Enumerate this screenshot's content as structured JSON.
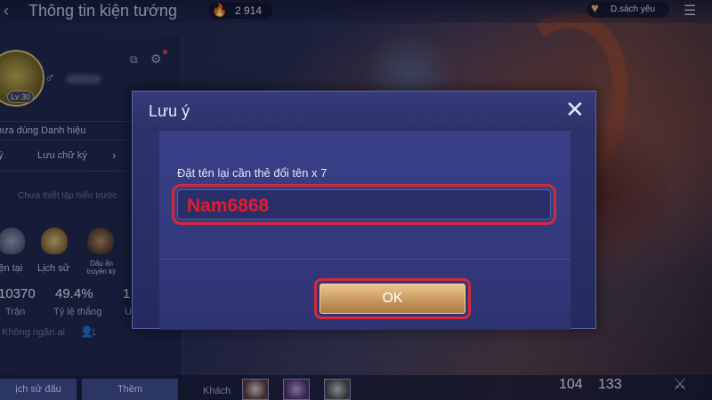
{
  "topbar": {
    "title": "Thông tin kiện tướng",
    "currency_value": "2 914",
    "favorites_label": "D.sách yêu"
  },
  "profile": {
    "level": "Lv 30",
    "title_label": "hưa dùng Danh hiệu",
    "signature_left": "ý",
    "signature_save": "Lưu chữ ký",
    "signature_placeholder": "Chưa thiết lập hiển trước",
    "medals": [
      "iện tại",
      "Lịch sử",
      "Dấu ấn truyền kỳ"
    ],
    "stats": [
      {
        "value": "10370",
        "label": "Trận"
      },
      {
        "value": "49.4%",
        "label": "Tỷ lệ thắng"
      },
      {
        "value": "1",
        "label": "U"
      }
    ],
    "visibility_text": "Không ngăn ai",
    "visibility_count": "1"
  },
  "bottombar": {
    "history_label": "ịch sử đấu",
    "add_label": "Thêm",
    "guest_label": "Khách",
    "count_a": "104",
    "count_b": "133"
  },
  "modal": {
    "title": "Lưu ý",
    "prompt": "Đặt tên lại cần thẻ đổi tên x 7",
    "name_value": "Nam6868",
    "ok_label": "OK"
  },
  "colors": {
    "highlight_border": "#d22a3a",
    "name_text": "#e21b2e",
    "ok_button": "#c99a5f",
    "modal_bg": "#2f3470"
  },
  "icons": [
    "back-arrow-icon",
    "fire-icon",
    "heart-icon",
    "menu-icon",
    "gender-icon",
    "copy-icon",
    "gear-icon",
    "person-icon",
    "close-icon",
    "scroll-icon"
  ]
}
